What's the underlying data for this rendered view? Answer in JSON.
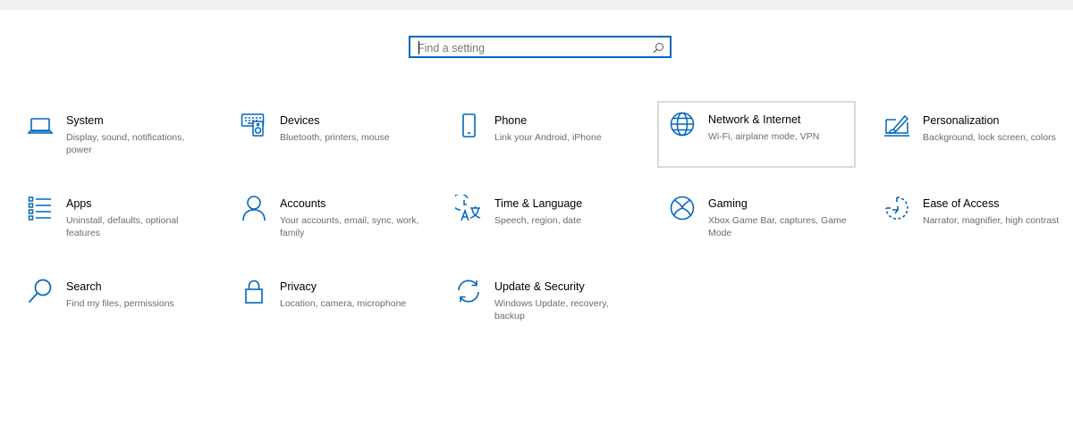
{
  "search": {
    "placeholder": "Find a setting",
    "value": ""
  },
  "accent_color": "#0067c0",
  "tiles": [
    {
      "title": "System",
      "desc": "Display, sound, notifications, power",
      "icon": "laptop-icon"
    },
    {
      "title": "Devices",
      "desc": "Bluetooth, printers, mouse",
      "icon": "keyboard-speaker-icon"
    },
    {
      "title": "Phone",
      "desc": "Link your Android, iPhone",
      "icon": "phone-icon"
    },
    {
      "title": "Network & Internet",
      "desc": "Wi-Fi, airplane mode, VPN",
      "icon": "globe-icon"
    },
    {
      "title": "Personalization",
      "desc": "Background, lock screen, colors",
      "icon": "paint-brush-icon"
    },
    {
      "title": "Apps",
      "desc": "Uninstall, defaults, optional features",
      "icon": "apps-list-icon"
    },
    {
      "title": "Accounts",
      "desc": "Your accounts, email, sync, work, family",
      "icon": "person-icon"
    },
    {
      "title": "Time & Language",
      "desc": "Speech, region, date",
      "icon": "time-language-icon"
    },
    {
      "title": "Gaming",
      "desc": "Xbox Game Bar, captures, Game Mode",
      "icon": "xbox-icon"
    },
    {
      "title": "Ease of Access",
      "desc": "Narrator, magnifier, high contrast",
      "icon": "ease-of-access-icon"
    },
    {
      "title": "Search",
      "desc": "Find my files, permissions",
      "icon": "search-icon"
    },
    {
      "title": "Privacy",
      "desc": "Location, camera, microphone",
      "icon": "lock-icon"
    },
    {
      "title": "Update & Security",
      "desc": "Windows Update, recovery, backup",
      "icon": "sync-arrows-icon"
    }
  ]
}
